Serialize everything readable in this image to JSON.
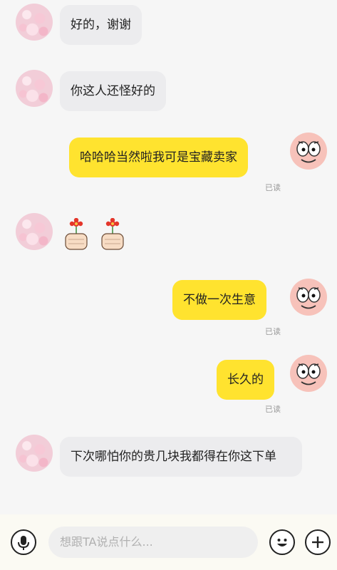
{
  "messages": [
    {
      "side": "in",
      "text": "好的，谢谢"
    },
    {
      "side": "in",
      "text": "你这人还怪好的"
    },
    {
      "side": "out",
      "text": "哈哈哈当然啦我可是宝藏卖家",
      "status": "已读"
    },
    {
      "side": "in",
      "type": "sticker",
      "stickers": [
        "flower-thumb-sticker",
        "flower-thumb-sticker"
      ]
    },
    {
      "side": "out",
      "text": "不做一次生意",
      "status": "已读"
    },
    {
      "side": "out",
      "text": "长久的",
      "status": "已读"
    },
    {
      "side": "in",
      "text": "下次哪怕你的贵几块我都得在你这下单"
    }
  ],
  "composer": {
    "placeholder": "想跟TA说点什么..."
  },
  "icons": {
    "voice": "microphone-icon",
    "emoji": "smile-icon",
    "more": "plus-icon"
  },
  "colors": {
    "incoming_bubble": "#ececee",
    "outgoing_bubble": "#ffe32f",
    "background": "#f6f6f6"
  }
}
